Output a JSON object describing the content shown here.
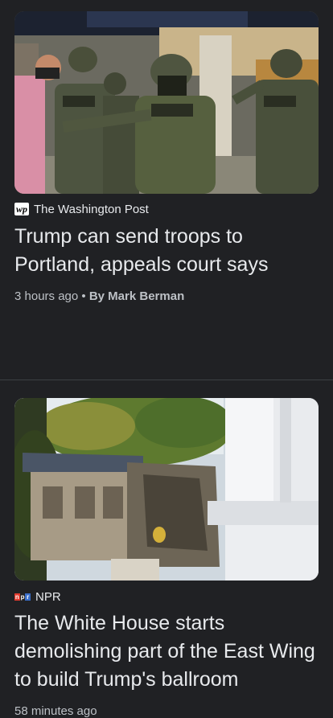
{
  "articles": [
    {
      "source": "The Washington Post",
      "source_icon": "washington-post-logo-icon",
      "headline": "Trump can send troops to Portland, appeals court says",
      "time": "3 hours ago",
      "separator": "•",
      "author": "By Mark Berman",
      "image": "photo of riot police officers with gas masks"
    },
    {
      "source": "NPR",
      "source_icon": "npr-logo-icon",
      "headline": "The White House starts demolishing part of the East Wing to build Trump's ballroom",
      "time": "58 minutes ago",
      "image": "photo of partially demolished building beside white columns"
    }
  ],
  "colors": {
    "background": "#202124",
    "text_primary": "#e8eaed",
    "text_secondary": "#bdc1c6",
    "npr_red": "#e23a2e",
    "npr_black": "#222222",
    "npr_blue": "#3a6ec9"
  }
}
